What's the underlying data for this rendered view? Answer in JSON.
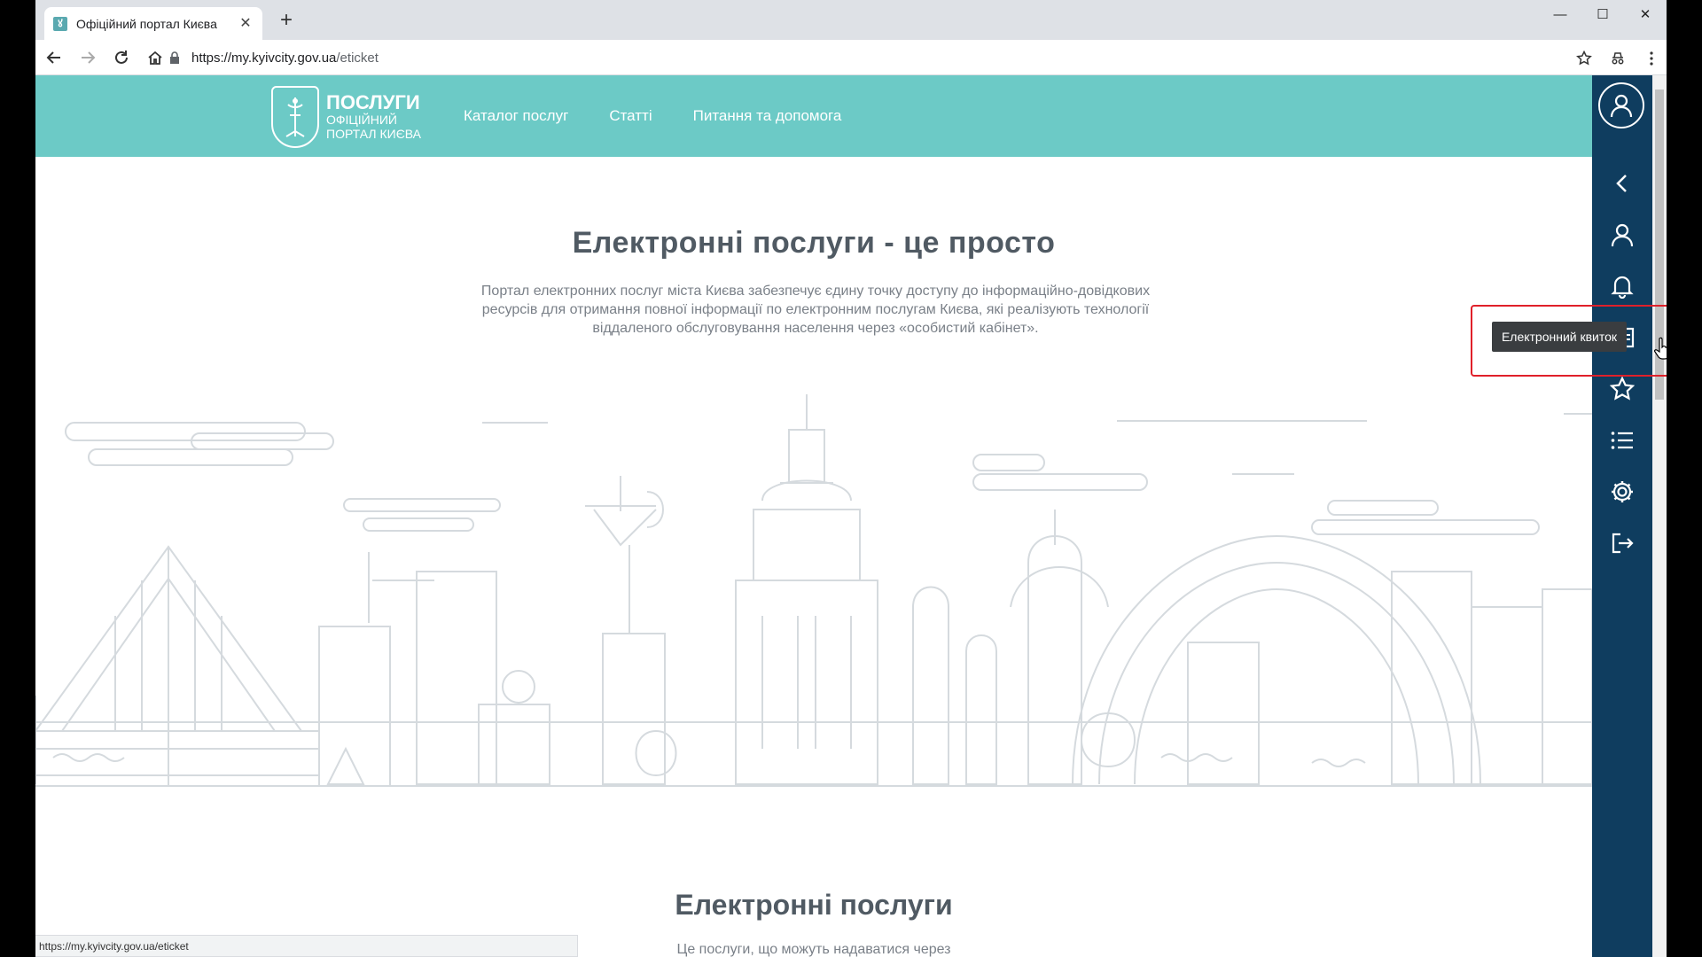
{
  "browser": {
    "tab_title": "Офіційний портал Києва",
    "url_host": "https://my.kyivcity.gov.ua",
    "url_path": "/eticket",
    "status_url": "https://my.kyivcity.gov.ua/eticket"
  },
  "site": {
    "logo_line1": "ПОСЛУГИ",
    "logo_line2": "ОФІЦІЙНИЙ",
    "logo_line3": "ПОРТАЛ КИЄВА",
    "nav": [
      "Каталог послуг",
      "Статті",
      "Питання та допомога"
    ],
    "brand_color": "#6ccac6"
  },
  "hero": {
    "title": "Електронні послуги - це просто",
    "text": "Портал електронних послуг міста Києва забезпечує єдину точку доступу до інформаційно-довідкових ресурсів для отримання повної інформації по електронним послугам Києва, які реалізують технології віддаленого обслуговування населення через «особистий кабінет»."
  },
  "section": {
    "title": "Електронні послуги",
    "subtitle": "Це послуги, що можуть надаватися через"
  },
  "side_panel": {
    "tooltip": "Електронний квиток",
    "icons": [
      "user-avatar-icon",
      "chevron-left-icon",
      "user-icon",
      "bell-icon",
      "eticket-icon",
      "star-icon",
      "list-icon",
      "gear-icon",
      "logout-icon"
    ],
    "color": "#0f3d5f"
  }
}
